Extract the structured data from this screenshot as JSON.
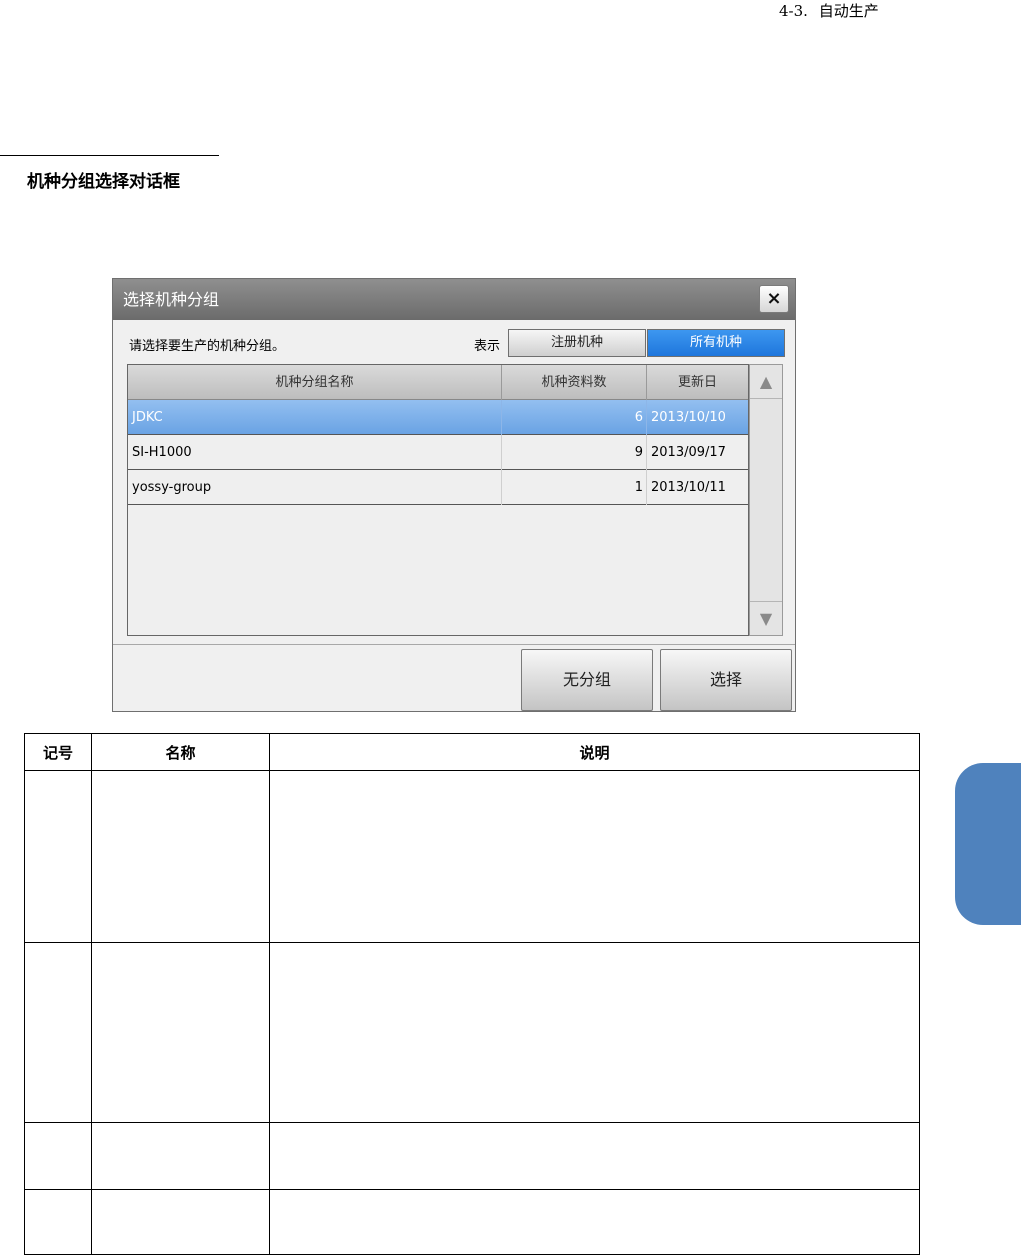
{
  "header": {
    "section_number": "4-3.",
    "section_title": "自动生产"
  },
  "section_heading": "机种分组选择对话框",
  "dialog": {
    "title": "选择机种分组",
    "close_label": "×",
    "prompt": "请选择要生产的机种分组。",
    "view_label": "表示",
    "view_options": [
      "注册机种",
      "所有机种"
    ],
    "selected_view": "所有机种",
    "columns": [
      "机种分组名称",
      "机种资料数",
      "更新日"
    ],
    "rows": [
      {
        "name": "JDKC",
        "count": "6",
        "date": "2013/10/10",
        "selected": true
      },
      {
        "name": "SI-H1000",
        "count": "9",
        "date": "2013/09/17",
        "selected": false
      },
      {
        "name": "yossy-group",
        "count": "1",
        "date": "2013/10/11",
        "selected": false
      }
    ],
    "scroll_up_icon": "arrow-up-icon",
    "scroll_down_icon": "arrow-down-icon",
    "buttons": {
      "no_group": "无分组",
      "select": "选择"
    }
  },
  "table": {
    "headers": [
      "记号",
      "名称",
      "说明"
    ],
    "rows": [
      {},
      {},
      {},
      {}
    ]
  },
  "colors": {
    "accent": "#1e76dc",
    "selected_row": "#6aa3e4",
    "tab_marker": "#4f82bd"
  }
}
